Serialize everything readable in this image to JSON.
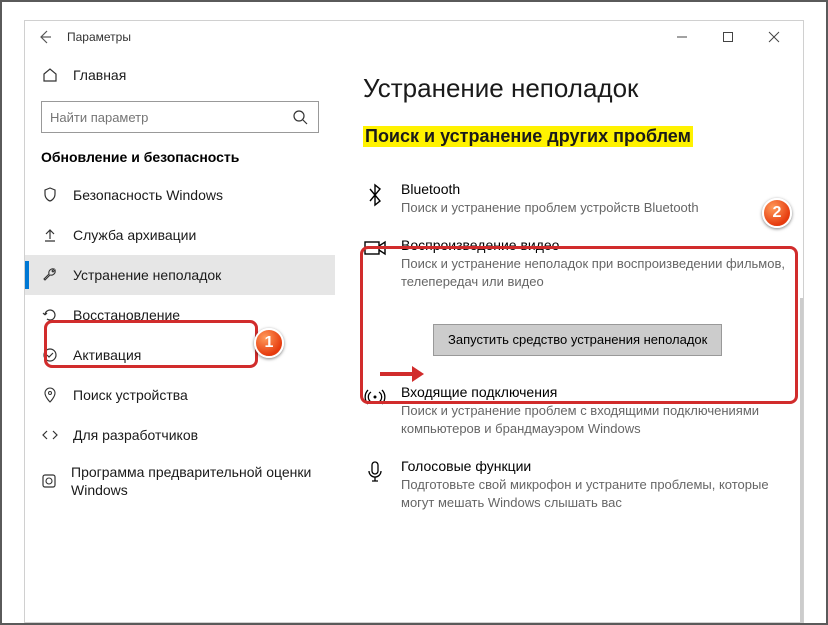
{
  "window": {
    "title": "Параметры"
  },
  "sidebar": {
    "home": "Главная",
    "search_placeholder": "Найти параметр",
    "section": "Обновление и безопасность",
    "items": [
      {
        "label": "Безопасность Windows"
      },
      {
        "label": "Служба архивации"
      },
      {
        "label": "Устранение неполадок"
      },
      {
        "label": "Восстановление"
      },
      {
        "label": "Активация"
      },
      {
        "label": "Поиск устройства"
      },
      {
        "label": "Для разработчиков"
      },
      {
        "label": "Программа предварительной оценки Windows"
      }
    ]
  },
  "content": {
    "page_title": "Устранение неполадок",
    "sub_title": "Поиск и устранение других проблем",
    "items": [
      {
        "title": "Bluetooth",
        "desc": "Поиск и устранение проблем устройств Bluetooth"
      },
      {
        "title": "Воспроизведение видео",
        "desc": "Поиск и устранение неполадок при воспроизведении фильмов, телепередач или видео"
      },
      {
        "title": "Входящие подключения",
        "desc": "Поиск и устранение проблем с входящими подключениями компьютеров и брандмауэром Windows"
      },
      {
        "title": "Голосовые функции",
        "desc": "Подготовьте свой микрофон и устраните проблемы, которые могут мешать Windows слышать вас"
      }
    ],
    "run_button": "Запустить средство устранения неполадок"
  },
  "badges": {
    "one": "1",
    "two": "2"
  }
}
